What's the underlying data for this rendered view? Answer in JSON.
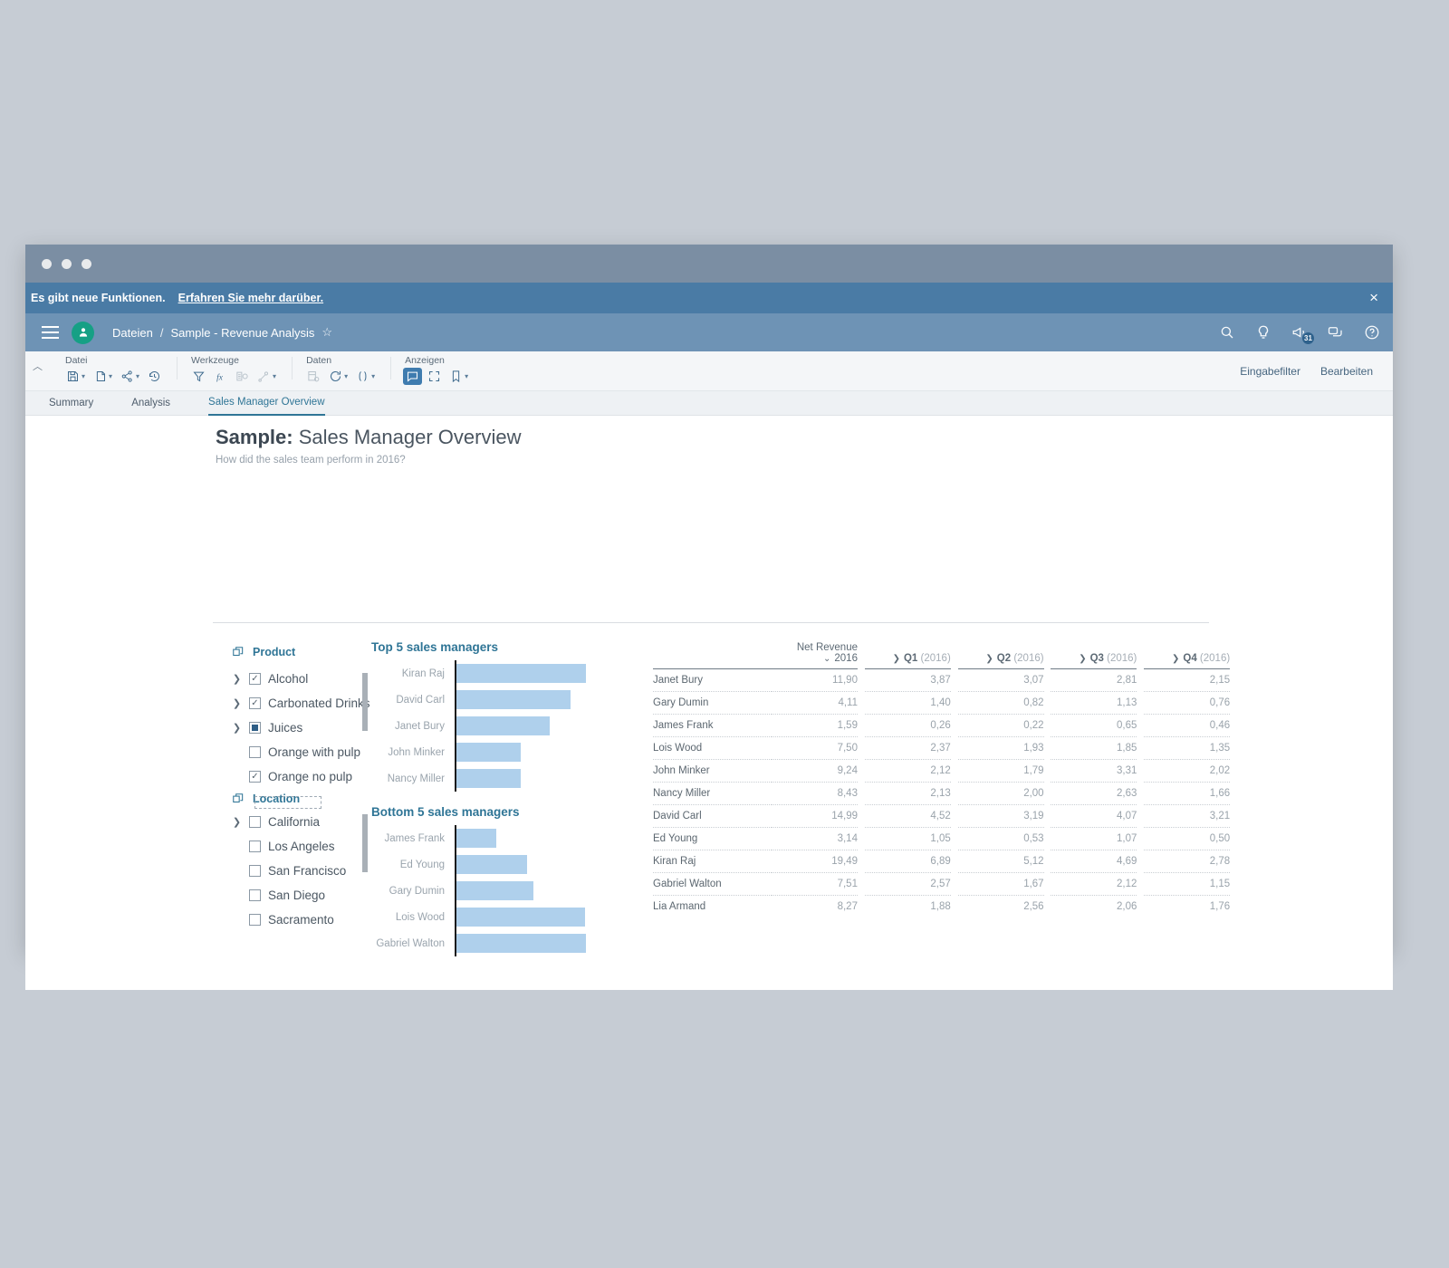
{
  "banner": {
    "message": "Es gibt neue Funktionen.",
    "link": "Erfahren Sie mehr darüber.",
    "close": "×"
  },
  "shellbar": {
    "breadcrumb_root": "Dateien",
    "separator": "/",
    "breadcrumb_current": "Sample - Revenue Analysis",
    "favorite": "☆",
    "notification_badge": "31"
  },
  "ribbon": {
    "groups": [
      {
        "label": "Datei",
        "items": [
          "save-icon",
          "duplicate-icon",
          "share-icon",
          "history-icon"
        ]
      },
      {
        "label": "Werkzeuge",
        "items": [
          "filter-icon",
          "formula-icon",
          "chart-icon",
          "link-icon"
        ]
      },
      {
        "label": "Daten",
        "items": [
          "data-source-icon",
          "refresh-icon",
          "variables-icon"
        ]
      },
      {
        "label": "Anzeigen",
        "items": [
          "comment-icon",
          "fullscreen-icon",
          "bookmark-icon"
        ]
      }
    ],
    "right": [
      "Eingabefilter",
      "Bearbeiten"
    ]
  },
  "tabs": [
    {
      "label": "Summary",
      "selected": false
    },
    {
      "label": "Analysis",
      "selected": false
    },
    {
      "label": "Sales Manager Overview",
      "selected": true
    }
  ],
  "page": {
    "title_bold": "Sample:",
    "title_rest": " Sales Manager Overview",
    "subtitle": "How did the sales team perform in 2016?"
  },
  "tree": {
    "product": {
      "group_label": "Product",
      "nodes": [
        {
          "label": "Alcohol",
          "state": "checked",
          "expandable": true,
          "expanded": false,
          "indent": false
        },
        {
          "label": "Carbonated Drinks",
          "state": "checked",
          "expandable": true,
          "expanded": false,
          "indent": false
        },
        {
          "label": "Juices",
          "state": "partial",
          "expandable": true,
          "expanded": true,
          "indent": false
        },
        {
          "label": "Orange with pulp",
          "state": "unchecked",
          "expandable": false,
          "expanded": false,
          "indent": true
        },
        {
          "label": "Orange no pulp",
          "state": "checked",
          "expandable": false,
          "expanded": false,
          "indent": true
        }
      ]
    },
    "location": {
      "group_label": "Location",
      "nodes": [
        {
          "label": "California",
          "state": "unchecked",
          "expandable": true,
          "expanded": true,
          "indent": false
        },
        {
          "label": "Los Angeles",
          "state": "unchecked",
          "expandable": false,
          "expanded": false,
          "indent": true
        },
        {
          "label": "San Francisco",
          "state": "unchecked",
          "expandable": false,
          "expanded": false,
          "indent": true
        },
        {
          "label": "San Diego",
          "state": "unchecked",
          "expandable": false,
          "expanded": false,
          "indent": true
        },
        {
          "label": "Sacramento",
          "state": "unchecked",
          "expandable": false,
          "expanded": false,
          "indent": true
        }
      ]
    }
  },
  "chart_data": [
    {
      "type": "bar",
      "title": "Top 5 sales managers",
      "orientation": "horizontal",
      "categories": [
        "Kiran Raj",
        "David Carl",
        "Janet Bury",
        "John Minker",
        "Nancy Miller"
      ],
      "values": [
        19.49,
        14.99,
        11.9,
        9.24,
        8.43
      ],
      "xlabel": "",
      "ylabel": "",
      "xlim": [
        0,
        19.49
      ],
      "grid": false,
      "legend": "none",
      "bar_color": "#afd0ec"
    },
    {
      "type": "bar",
      "title": "Bottom 5 sales managers",
      "orientation": "horizontal",
      "categories": [
        "James Frank",
        "Ed Young",
        "Gary Dumin",
        "Lois Wood",
        "Gabriel Walton"
      ],
      "values": [
        1.59,
        3.14,
        4.11,
        7.5,
        7.51
      ],
      "xlabel": "",
      "ylabel": "",
      "xlim": [
        0,
        7.51
      ],
      "grid": false,
      "legend": "none",
      "bar_color": "#afd0ec"
    },
    {
      "type": "table",
      "title": "Net Revenue",
      "columns": [
        "",
        "2016",
        "Q1 (2016)",
        "Q2 (2016)",
        "Q3 (2016)",
        "Q4 (2016)"
      ],
      "rows": [
        [
          "Janet Bury",
          "11,90",
          "3,87",
          "3,07",
          "2,81",
          "2,15"
        ],
        [
          "Gary Dumin",
          "4,11",
          "1,40",
          "0,82",
          "1,13",
          "0,76"
        ],
        [
          "James Frank",
          "1,59",
          "0,26",
          "0,22",
          "0,65",
          "0,46"
        ],
        [
          "Lois Wood",
          "7,50",
          "2,37",
          "1,93",
          "1,85",
          "1,35"
        ],
        [
          "John Minker",
          "9,24",
          "2,12",
          "1,79",
          "3,31",
          "2,02"
        ],
        [
          "Nancy Miller",
          "8,43",
          "2,13",
          "2,00",
          "2,63",
          "1,66"
        ],
        [
          "David Carl",
          "14,99",
          "4,52",
          "3,19",
          "4,07",
          "3,21"
        ],
        [
          "Ed Young",
          "3,14",
          "1,05",
          "0,53",
          "1,07",
          "0,50"
        ],
        [
          "Kiran Raj",
          "19,49",
          "6,89",
          "5,12",
          "4,69",
          "2,78"
        ],
        [
          "Gabriel Walton",
          "7,51",
          "2,57",
          "1,67",
          "2,12",
          "1,15"
        ],
        [
          "Lia Armand",
          "8,27",
          "1,88",
          "2,56",
          "2,06",
          "1,76"
        ]
      ]
    }
  ],
  "table": {
    "metric_label": "Net Revenue",
    "year_label": "2016",
    "quarter_headers": [
      {
        "q": "Q1",
        "yr": "(2016)"
      },
      {
        "q": "Q2",
        "yr": "(2016)"
      },
      {
        "q": "Q3",
        "yr": "(2016)"
      },
      {
        "q": "Q4",
        "yr": "(2016)"
      }
    ]
  },
  "colors": {
    "accent": "#2f7596",
    "bar": "#afd0ec",
    "banner": "#4a7ba5",
    "shellbar": "#6e93b5",
    "titlebar": "#7b8ea3",
    "desktop": "#c6ccd4"
  }
}
